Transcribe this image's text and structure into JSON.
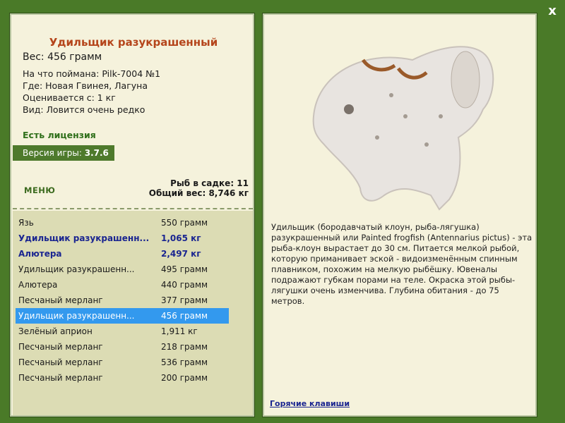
{
  "close_label": "x",
  "fish": {
    "title": "Удильщик разукрашенный",
    "weight": "Вес: 456 грамм",
    "info": [
      "На что поймана: Pilk-7004 №1",
      "Где: Новая Гвинея, Лагуна",
      "Оценивается с: 1 кг",
      "Вид: Ловится очень редко"
    ]
  },
  "license": "Есть лицензия",
  "version": {
    "label": "Версия игры:",
    "value": "3.7.6"
  },
  "menu_label": "МЕНЮ",
  "stats": {
    "count": "Рыб в садке: 11",
    "total": "Общий вес: 8,746 кг"
  },
  "catch_list": [
    {
      "name": "Язь",
      "weight": "550 грамм",
      "state": "normal"
    },
    {
      "name": "Удильщик разукрашенн...",
      "weight": "1,065 кг",
      "state": "highlight"
    },
    {
      "name": "Алютера",
      "weight": "2,497 кг",
      "state": "highlight"
    },
    {
      "name": "Удильщик разукрашенн...",
      "weight": "495 грамм",
      "state": "normal"
    },
    {
      "name": "Алютера",
      "weight": "440 грамм",
      "state": "normal"
    },
    {
      "name": "Песчаный мерланг",
      "weight": "377 грамм",
      "state": "normal"
    },
    {
      "name": "Удильщик разукрашенн...",
      "weight": "456 грамм",
      "state": "selected"
    },
    {
      "name": "Зелёный априон",
      "weight": "1,911 кг",
      "state": "normal"
    },
    {
      "name": "Песчаный мерланг",
      "weight": "218 грамм",
      "state": "normal"
    },
    {
      "name": "Песчаный мерланг",
      "weight": "536 грамм",
      "state": "normal"
    },
    {
      "name": "Песчаный мерланг",
      "weight": "200 грамм",
      "state": "normal"
    }
  ],
  "description": "Удильщик (бородавчатый клоун, рыба-лягушка) разукрашенный или Painted frogfish (Antennarius pictus) - эта рыба-клоун вырастает до 30 см. Питается мелкой рыбой, которую приманивает эской - видоизменённым спинным плавником, похожим на мелкую рыбёшку. Ювеналы подражают губкам порами на теле. Окраска этой рыбы-лягушки очень изменчива. Глубина обитания - до 75 метров.",
  "hotkeys_label": "Горячие клавиши",
  "colors": {
    "background": "#4a7a28",
    "panel": "#f5f2dc",
    "list_bg": "#dcdcb4",
    "title": "#b5451b",
    "highlight": "#1a2590",
    "selected": "#3399ee"
  }
}
